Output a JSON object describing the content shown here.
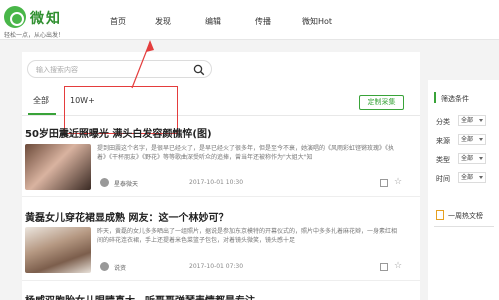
{
  "header": {
    "brand": "微知",
    "slogan": "轻松一点，从心出发！",
    "nav": [
      "首页",
      "发现",
      "编辑",
      "传播",
      "微知Hot"
    ]
  },
  "search": {
    "placeholder": "输入搜索内容"
  },
  "tabs": {
    "all": "全部",
    "callout": "10W+",
    "custom_button": "定制采集"
  },
  "articles": [
    {
      "title": "50岁田震近照曝光 满头白发容颜憔悴(图)",
      "desc": "提到田震这个名字，是很早已经火了，是早已经火了很多年，但是至今不衰，她演唱的《风雨彩虹铿锵玫瑰》《执着》《干杯朋友》《野花》等等歌曲深受听众的追捧，曾当年还被称作为\"大姐大\"知",
      "source": "星泰微天",
      "time": "2017-10-01 10:30"
    },
    {
      "title": "黄磊女儿穿花裙显成熟 网友：这一个林妙可？",
      "desc": "昨天，黄磊的女儿多多晒出了一组照片，据说是参加东京模特的开幕仪式的，照片中多多扎着麻花辫，一身素红相间的碎花连衣裙，手上还提着米色菜篮子包包，对着镜头微笑，镜头感十足",
      "source": "说资",
      "time": "2017-10-01 07:30"
    },
    {
      "title": "杨威双胞胎女儿眼睛真大，听哥哥弹琴表情都是专注"
    }
  ],
  "sidebar": {
    "filter_title": "筛选条件",
    "filters": [
      {
        "label": "分类",
        "value": "全部"
      },
      {
        "label": "来源",
        "value": "全部"
      },
      {
        "label": "类型",
        "value": "全部"
      },
      {
        "label": "时间",
        "value": "全部"
      }
    ],
    "hot_title": "一周热文榜"
  },
  "colors": {
    "brand_green": "#39a339",
    "callout_red": "#e43d3d"
  }
}
